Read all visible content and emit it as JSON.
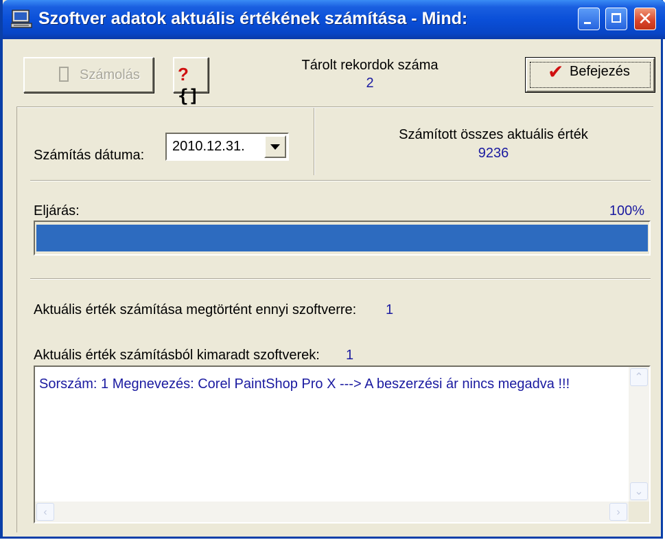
{
  "window": {
    "title": "Szoftver adatok aktuális értékének számítása - Mind:",
    "title_icon": "computer-icon",
    "controls": {
      "minimize": "minimize-icon",
      "maximize": "maximize-icon",
      "close": "close-icon"
    },
    "close_glyph": "✕"
  },
  "toolbar": {
    "calculate_label": "Számolás",
    "calculate_icon": "calculator-icon",
    "help_q": "?",
    "help_brace": "{]",
    "help_icon": "help-code-icon",
    "stored_records_caption": "Tárolt rekordok száma",
    "stored_records_value": "2",
    "finish_label": "Befejezés",
    "finish_check": "✔",
    "finish_icon": "checkmark-icon"
  },
  "calc": {
    "date_label": "Számítás dátuma:",
    "date_value": "2010.12.31.",
    "total_caption": "Számított összes aktuális érték",
    "total_value": "9236"
  },
  "progress": {
    "label": "Eljárás:",
    "percent_text": "100%",
    "fraction": 1.0,
    "color": "#2d6bbf"
  },
  "results": {
    "done_label": "Aktuális érték számítása megtörtént ennyi szoftverre:",
    "done_value": "1",
    "missed_label": "Aktuális érték számításból kimaradt szoftverek:",
    "missed_value": "1",
    "lines": [
      "Sorszám: 1   Megnevezés: Corel PaintShop Pro X   --->   A beszerzési ár nincs megadva !!!"
    ]
  },
  "scroll_glyphs": {
    "up": "⌃",
    "down": "⌄",
    "left": "‹",
    "right": "›"
  },
  "colors": {
    "titlebar": "#0a4fd8",
    "window_face": "#ece9d8",
    "value_text": "#1a1aa0",
    "progress_fill": "#2d6bbf"
  }
}
